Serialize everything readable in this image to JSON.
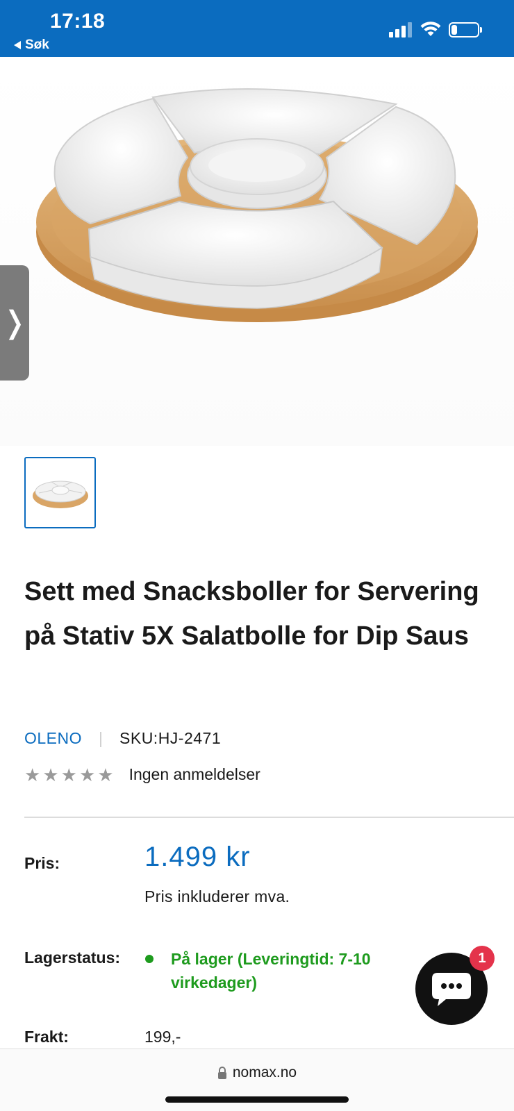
{
  "status_bar": {
    "time": "17:18",
    "back_label": "Søk",
    "signal_bars": 3,
    "signal_bars_total": 4,
    "battery_level": 0.2,
    "background_color": "#0b6cbf"
  },
  "gallery": {
    "next_icon": "chevron-right-icon",
    "thumbnail_count": 1,
    "selected_thumbnail": 1
  },
  "product": {
    "title": "Sett med Snacksboller for Servering på Stativ 5X Salatbolle for Dip Saus",
    "vendor": "OLENO",
    "sku": "SKU:HJ-2471",
    "rating_stars": 0,
    "rating_max": 5,
    "review_text": "Ingen anmeldelser"
  },
  "details": {
    "price_label": "Pris:",
    "price": "1.499 kr",
    "price_note": "Pris inkluderer mva.",
    "stock_label": "Lagerstatus:",
    "stock_text": "På lager (Leveringtid: 7-10 virkedager)",
    "freight_label": "Frakt:",
    "freight_value": "199,-"
  },
  "chat": {
    "icon": "chat-bubble-icon",
    "badge_count": "1"
  },
  "browser": {
    "url": "nomax.no",
    "lock_icon": "lock-icon"
  },
  "colors": {
    "accent": "#0b6cbf",
    "in_stock": "#1e9b1e",
    "badge": "#e4334b",
    "star_empty": "#9a9a9a"
  }
}
